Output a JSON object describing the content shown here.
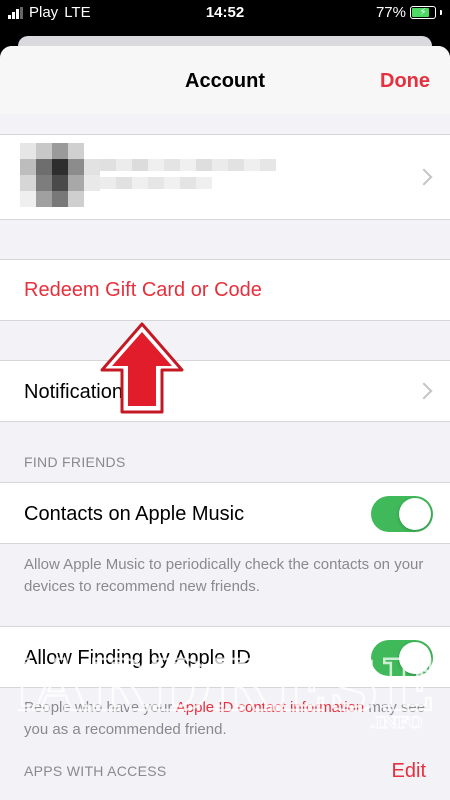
{
  "status_bar": {
    "carrier": "Play",
    "network": "LTE",
    "time": "14:52",
    "battery": "77%",
    "battery_level": 0.77
  },
  "nav": {
    "title": "Account",
    "done_label": "Done"
  },
  "menu": {
    "redeem_label": "Redeem Gift Card or Code",
    "notifications_label": "Notifications"
  },
  "find_friends": {
    "header": "FIND FRIENDS",
    "contacts_label": "Contacts on Apple Music",
    "contacts_toggle": "on",
    "contacts_footer": "Allow Apple Music to periodically check the contacts on your devices to recommend new friends.",
    "finding_label": "Allow Finding by Apple ID",
    "finding_toggle": "on",
    "finding_footer_pre": "People who have your ",
    "finding_footer_link": "Apple ID contact information",
    "finding_footer_post": " may see you as a recommended friend."
  },
  "apps_with_access": {
    "header": "APPS WITH ACCESS",
    "edit_label": "Edit"
  },
  "watermark": {
    "text": "HARDRESET",
    "sub": ".INFO"
  },
  "colors": {
    "accent": "#e6303d",
    "toggle_on": "#3fb959",
    "background": "#f2f2f7"
  }
}
